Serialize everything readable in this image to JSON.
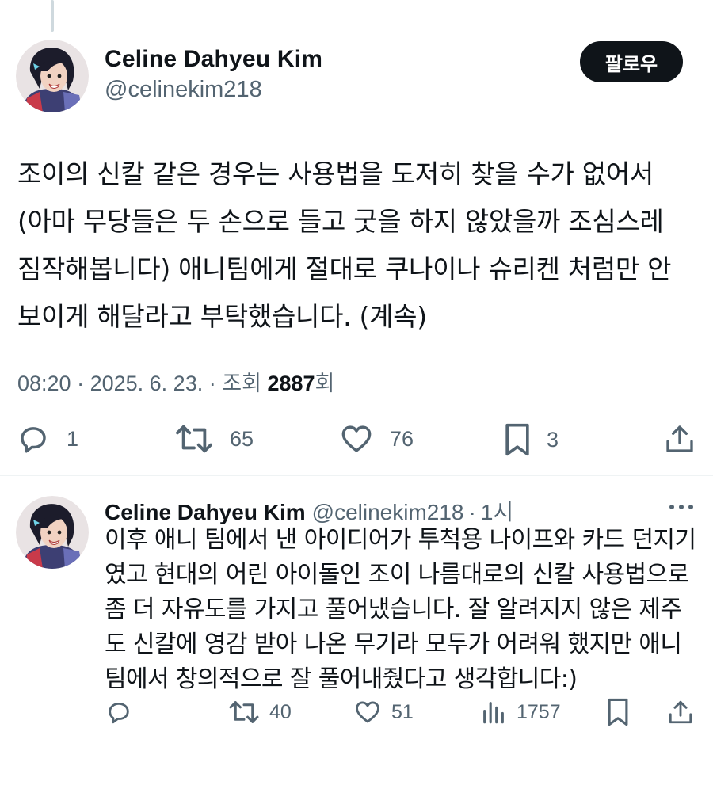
{
  "main_tweet": {
    "author_name": "Celine Dahyeu Kim",
    "author_handle": "@celinekim218",
    "follow_label": "팔로우",
    "text_lines": [
      "조이의 신칼 같은 경우는 사용법을 도저히 찾을 수가 없어서",
      "(아마 무당들은 두 손으로 들고 굿을 하지 않았을까 조심스레",
      "짐작해봅니다) 애니팀에게 절대로 쿠나이나 슈리켄 처럼만 안",
      "보이게 해달라고 부탁했습니다. (계속)"
    ],
    "time": "08:20",
    "date": "2025. 6. 23.",
    "views_label": "조회",
    "views_count": "2887",
    "views_suffix": "회",
    "replies": "1",
    "reposts": "65",
    "likes": "76",
    "bookmarks": "3"
  },
  "reply_tweet": {
    "author_name": "Celine Dahyeu Kim",
    "author_handle": "@celinekim218",
    "time_ago": "1시",
    "text_lines": [
      "이후 애니 팀에서 낸 아이디어가 투척용 나이프와 카드 던지기",
      "였고 현대의 어린 아이돌인 조이 나름대로의 신칼 사용법으로",
      "좀 더 자유도를 가지고 풀어냈습니다. 잘 알려지지 않은 제주",
      "도 신칼에 영감 받아 나온 무기라 모두가 어려워 했지만 애니",
      "팀에서 창의적으로 잘 풀어내줬다고 생각합니다:)"
    ],
    "reposts": "40",
    "likes": "51",
    "views": "1757"
  },
  "icons": {
    "reply": "reply-icon",
    "repost": "repost-icon",
    "like": "heart-icon",
    "bookmark": "bookmark-icon",
    "share": "share-icon",
    "views": "views-chart-icon",
    "more": "more-dots-icon"
  },
  "colors": {
    "text": "#0f1419",
    "secondary": "#536471",
    "follow_bg": "#0f1419"
  }
}
